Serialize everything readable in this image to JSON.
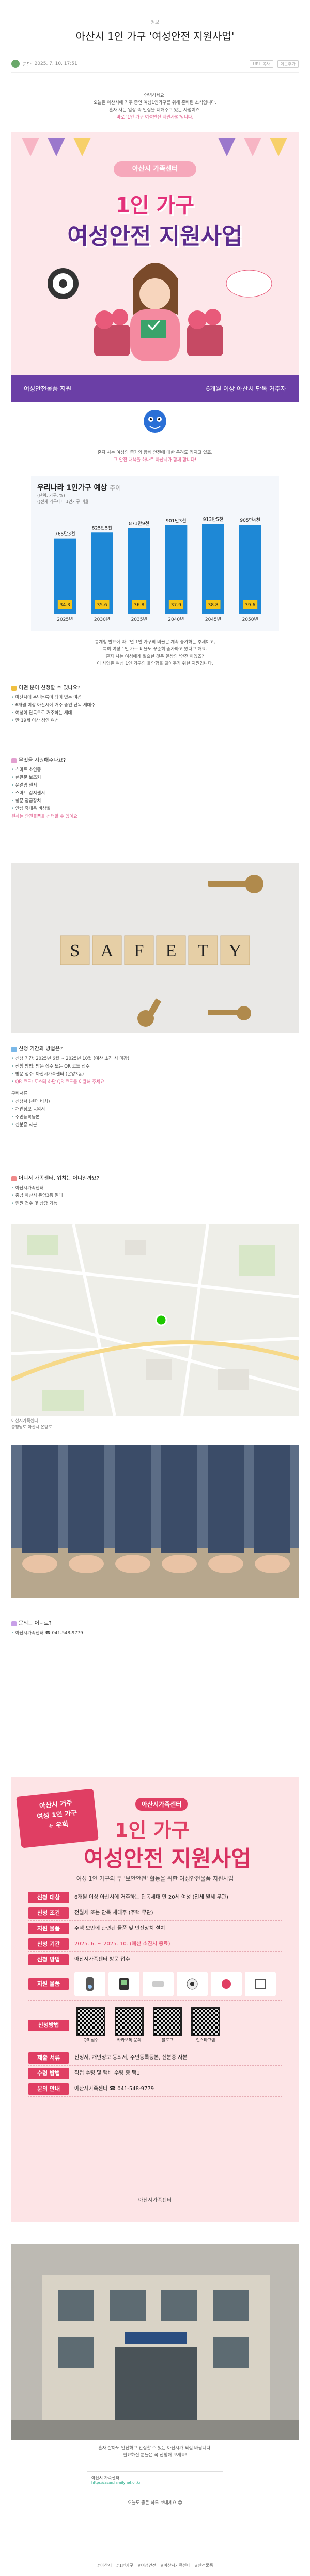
{
  "post": {
    "category": "정보",
    "title": "아산시 1인 가구 '여성안전 지원사업'",
    "author": "군만",
    "date": "2025. 7. 10. 17:51",
    "actions": [
      "URL 복사",
      "이웃추가"
    ]
  },
  "intro": [
    "안녕하세요!",
    "오늘은 아산시에 거주 중인 여성1인가구를 위해 준비된 소식입니다.",
    "혼자 사는 일상 속 안심을 더해주고 있는 사업이죠.",
    "바로 '1인 가구 여성안전 지원사업'입니다."
  ],
  "poster1": {
    "badge": "아산시 가족센터",
    "title_line1": "1인 가구",
    "title_line2": "여성안전 지원사업",
    "bottom_left": "여성안전물품 지원",
    "bottom_right": "6개월 이상 아산시 단독 거주자"
  },
  "after_poster": [
    "혼자 사는 여성의 증가와 함께 안전에 대한 우려도 커지고 있죠.",
    "그 안전 대책을 하나로 아산시가 함께 합니다!"
  ],
  "chart": {
    "title": "우리나라 1인가구 예상",
    "title_suffix": "추이",
    "unit": "(단위: 가구, %)",
    "note": "()전체 가구대비 1인가구 비율"
  },
  "chart_data": {
    "type": "bar",
    "title": "우리나라 1인가구 예상 추이",
    "categories": [
      "2025년",
      "2030년",
      "2035년",
      "2040년",
      "2045년",
      "2050년"
    ],
    "values": [
      765,
      825,
      871,
      901,
      913,
      905
    ],
    "value_labels": [
      "765만3천",
      "825만5천",
      "871만9천",
      "901만3천",
      "913만5천",
      "905만4천"
    ],
    "ratios": [
      "34.3",
      "35.6",
      "36.8",
      "37.9",
      "38.8",
      "39.6"
    ],
    "ylim": [
      0,
      1000
    ],
    "colors": {
      "bar": "#1e88d6",
      "ratio_box": "#f5c518"
    }
  },
  "chart_caption": [
    "통계청 발표에 따르면 1인 가구의 비율은 계속 증가하는 추세이고,",
    "특히 여성 1인 가구 비율도 꾸준히 증가하고 있다고 해요.",
    "혼자 사는 여성에게 필요한 것은 일상의 '안전'이겠죠?",
    "이 사업은 여성 1인 가구의 불안함을 덜어주기 위한 지원입니다."
  ],
  "section_why": {
    "heading": "어떤 분이 신청할 수 있나요?",
    "items": [
      "아산시에 주민등록이 되어 있는 여성",
      "6개월 이상 아산시에 거주 중인 단독 세대주",
      "여성이 단독으로 거주하는 세대",
      "만 19세 이상 성인 여성"
    ]
  },
  "section_items": {
    "heading": "무엇을 지원해주나요?",
    "items": [
      "스마트 초인종",
      "현관문 보조키",
      "문열림 센서",
      "스마트 감지센서",
      "창문 잠금장치",
      "안심 휴대용 비상벨"
    ],
    "note": "원하는 안전물품을 선택할 수 있어요"
  },
  "safety_sign": "SAFETY",
  "section_apply": {
    "heading": "신청 기간과 방법은?",
    "items": [
      "신청 기간: 2025년 6월 ~ 2025년 10월 (예산 소진 시 마감)",
      "신청 방법: 방문 접수 또는 QR 코드 접수",
      "방문 접수: 아산시가족센터 (온양3동)",
      "QR 코드: 포스터 하단 QR 코드를 이용해 주세요"
    ],
    "docs_heading": "구비서류",
    "docs": [
      "신청서 (센터 비치)",
      "개인정보 동의서",
      "주민등록등본",
      "신분증 사본"
    ]
  },
  "section_where": {
    "heading": "어디서 가족센터, 위치는 어디일까요?",
    "items": [
      "아산시가족센터",
      "충남 아산시 온양3동 일대",
      "민원 접수 및 상담 가능"
    ]
  },
  "map_caption": [
    "아산시가족센터",
    "충청남도 아산시 온양로"
  ],
  "section_contact": {
    "heading": "문의는 어디로?",
    "items": [
      "아산시가족센터 ☎ 041-548-9779"
    ]
  },
  "poster2": {
    "tag_lines": [
      "아산시 거주",
      "여성 1인 가구",
      "+ 우회"
    ],
    "org": "아산시가족센터",
    "title_line1": "1인 가구",
    "title_line2": "여성안전 지원사업",
    "subtitle": "여성 1인 가구의 두 '보안안전' 활동을 위한 여성안전물품 지원사업",
    "rows": [
      {
        "label": "신청 대상",
        "value": "6개월 이상 아산시에 거주하는 단독세대 만 20세 여성 (전세·월세 무관)",
        "red": false
      },
      {
        "label": "신청 조건",
        "value": "전월세 또는 단독 세대주 (주택 무관)",
        "red": false
      },
      {
        "label": "지원 물품",
        "value": "주택 보안에 관련된 물품 및 안전장치 설치",
        "red": false
      },
      {
        "label": "신청 기간",
        "value": "2025. 6. ~ 2025. 10. (예산 소진시 종료)",
        "red": true
      },
      {
        "label": "신청 방법",
        "value": "아산시가족센터 방문 접수",
        "red": false
      }
    ],
    "items_label": "지원 물품",
    "qr_label": "신청방법",
    "qr_items": [
      "QR 접수",
      "카카오톡 문의",
      "블로그",
      "인스타그램"
    ],
    "notes": [
      {
        "label": "제출 서류",
        "value": "신청서, 개인정보 동의서, 주민등록등본, 신분증 사본"
      },
      {
        "label": "수령 방법",
        "value": "직접 수령 및 택배 수령 중 택1"
      },
      {
        "label": "문의 안내",
        "value": "아산시가족센터 ☎ 041-548-9779"
      }
    ],
    "footer": "아산시가족센터"
  },
  "closing": [
    "혼자 살아도 안전하고 안심할 수 있는 아산시가 되길 바랍니다.",
    "필요하신 분들은 꼭 신청해 보세요!"
  ],
  "linkcard": {
    "title": "아산시 가족센터",
    "url": "https://asan.familynet.or.kr"
  },
  "thanks": "오늘도 좋은 하루 보내세요 😊",
  "tags": [
    "#아산시",
    "#1인가구",
    "#여성안전",
    "#아산시가족센터",
    "#안전물품"
  ]
}
